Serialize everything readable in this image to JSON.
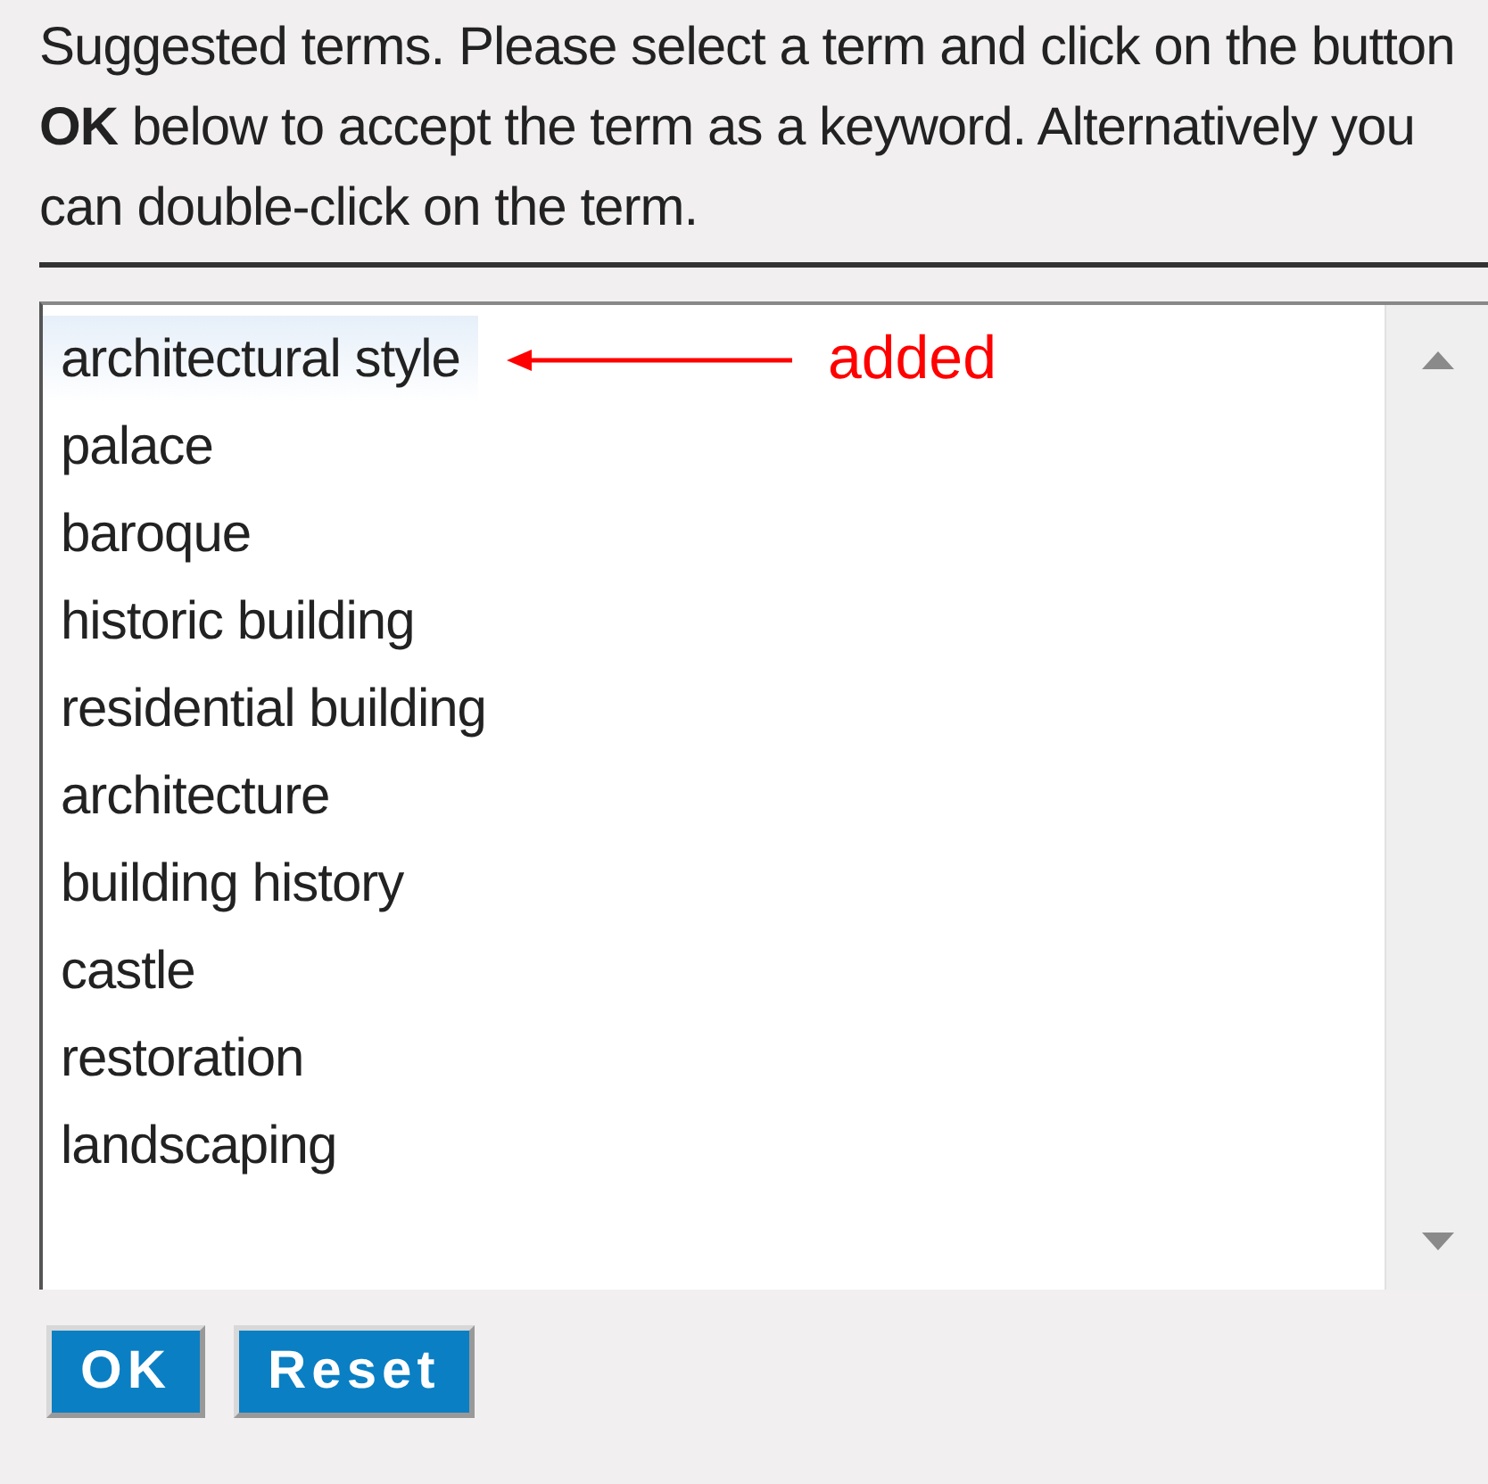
{
  "instructions": "Suggested terms. Please select a term and click on the button **OK** below to accept the term as a keyword. Alternatively you can double-click on the term.",
  "terms": [
    {
      "label": "architectural style",
      "selected": true
    },
    {
      "label": "palace",
      "selected": false
    },
    {
      "label": "baroque",
      "selected": false
    },
    {
      "label": "historic building",
      "selected": false
    },
    {
      "label": "residential building",
      "selected": false
    },
    {
      "label": "architecture",
      "selected": false
    },
    {
      "label": "building history",
      "selected": false
    },
    {
      "label": "castle",
      "selected": false
    },
    {
      "label": "restoration",
      "selected": false
    },
    {
      "label": "landscaping",
      "selected": false
    }
  ],
  "annotation": {
    "label": "added"
  },
  "buttons": [
    "OK",
    "Reset"
  ]
}
